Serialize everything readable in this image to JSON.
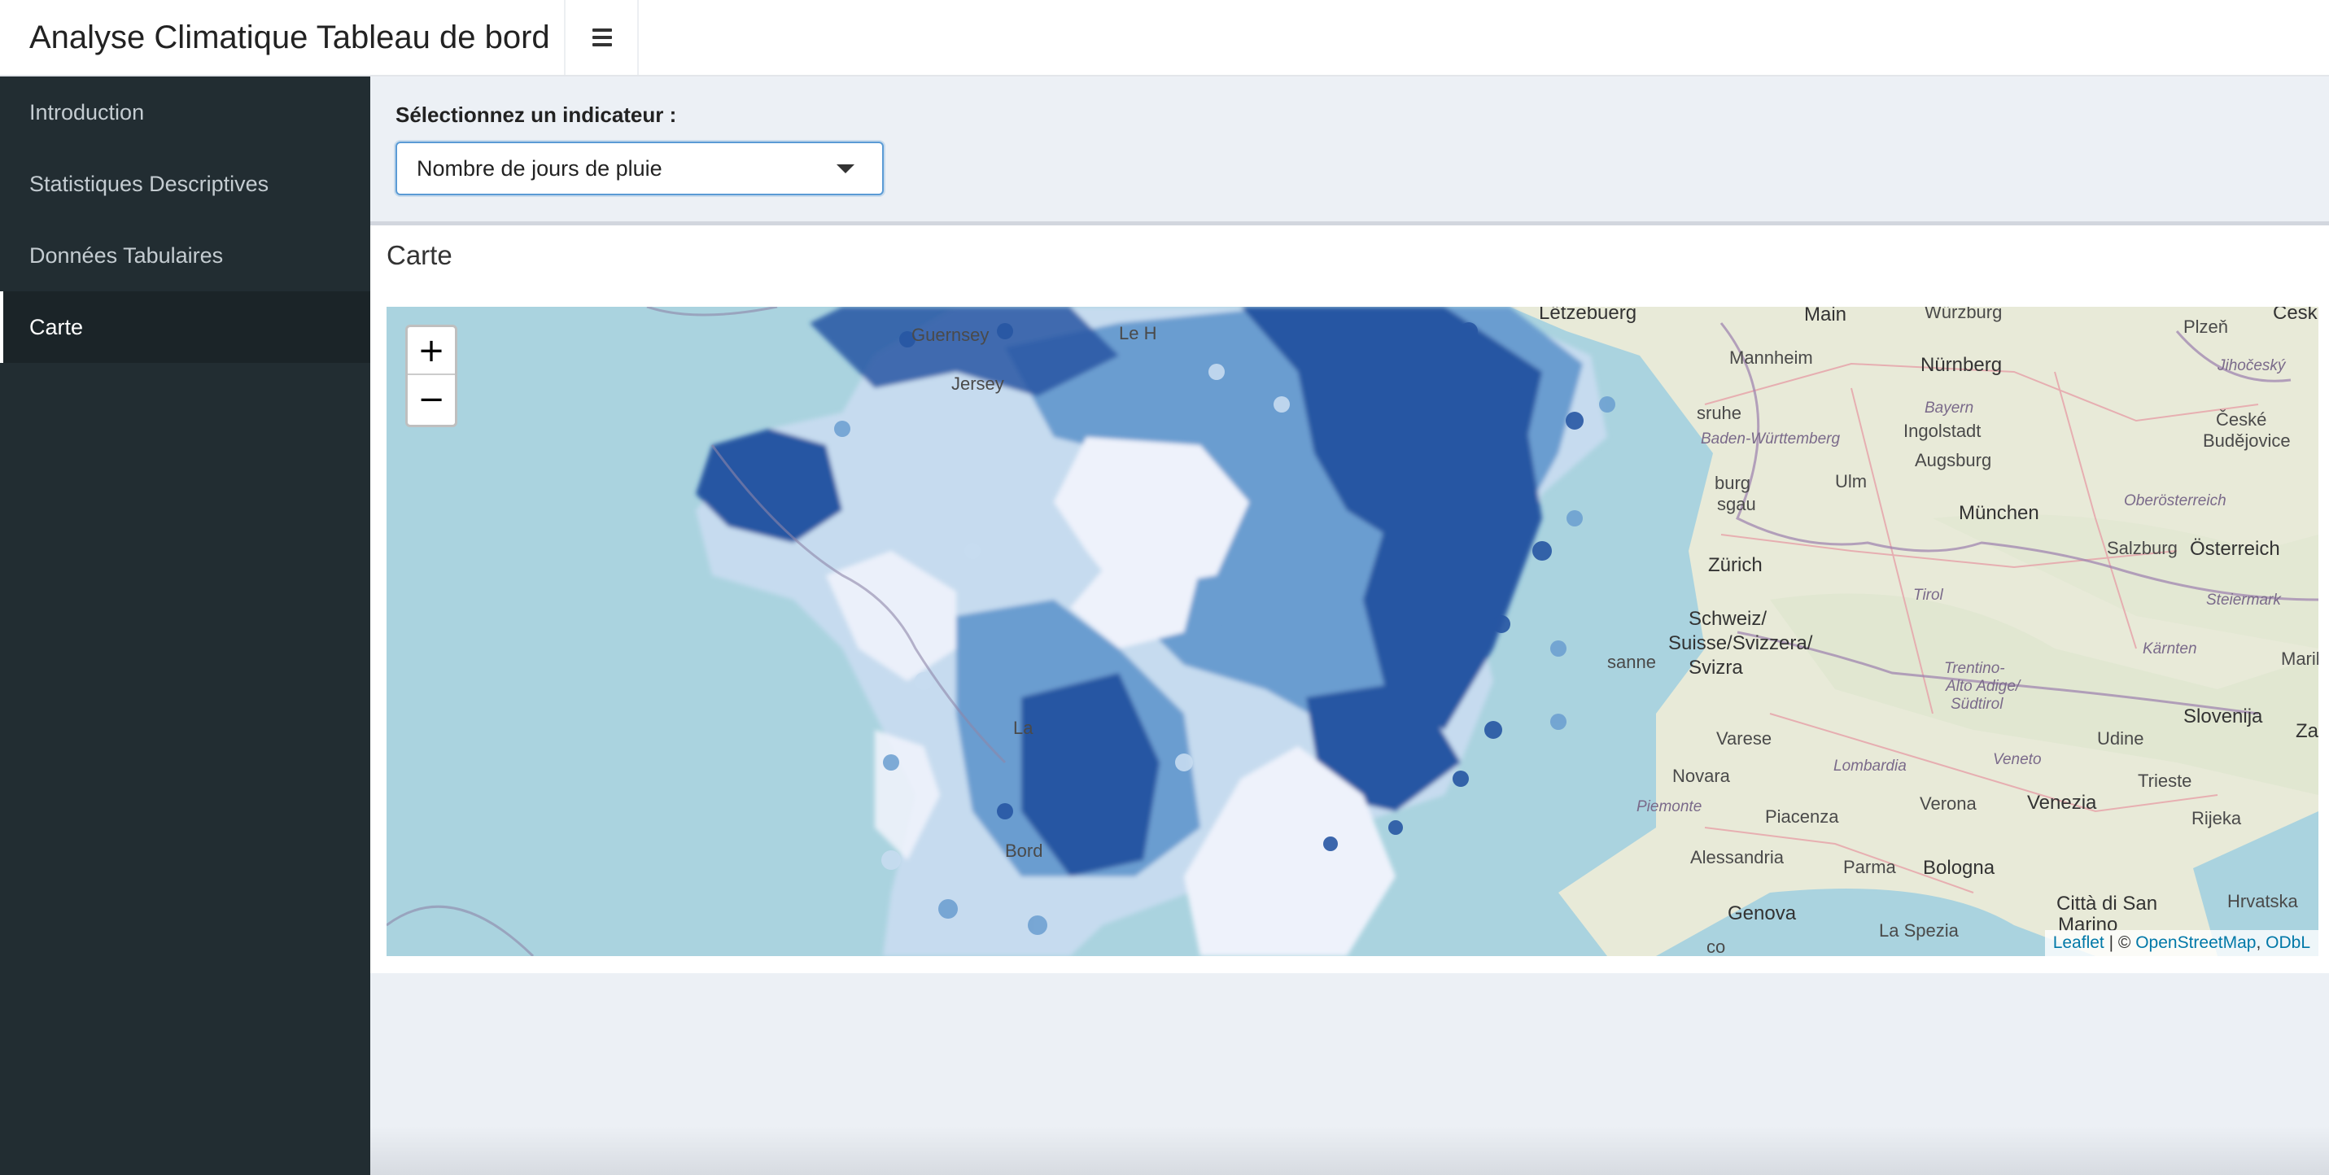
{
  "header": {
    "title": "Analyse Climatique Tableau de bord",
    "toggle_icon": "hamburger-menu-icon"
  },
  "sidebar": {
    "items": [
      {
        "label": "Introduction",
        "active": false
      },
      {
        "label": "Statistiques Descriptives",
        "active": false
      },
      {
        "label": "Données Tabulaires",
        "active": false
      },
      {
        "label": "Carte",
        "active": true
      }
    ]
  },
  "selector": {
    "label": "Sélectionnez un indicateur :",
    "value": "Nombre de jours de pluie"
  },
  "box": {
    "title": "Carte"
  },
  "map": {
    "zoom_in": "+",
    "zoom_out": "−",
    "attribution": {
      "leaflet": "Leaflet",
      "separator": " | © ",
      "osm": "OpenStreetMap",
      "comma": ", ",
      "license": "ODbL"
    },
    "labels": {
      "guernsey": "Guernsey",
      "jersey": "Jersey",
      "le_h": "Le H",
      "letzebuerg": "Lëtzebuerg",
      "main": "Main",
      "wurzburg": "Würzburg",
      "cesk": "Česk",
      "mannheim": "Mannheim",
      "nurnberg": "Nürnberg",
      "plzen": "Plzeň",
      "jihoceske": "Jihočeský",
      "bayern": "Bayern",
      "sruhe": "sruhe",
      "baden": "Baden-Württemberg",
      "ingolstadt": "Ingolstadt",
      "ceske": "České",
      "budejovice": "Budějovice",
      "augsburg": "Augsburg",
      "burg": "burg",
      "sgau": "sgau",
      "ulm": "Ulm",
      "munchen": "München",
      "ober": "Oberösterreich",
      "zurich": "Zürich",
      "salzburg": "Salzburg",
      "osterreich": "Österreich",
      "tirol": "Tirol",
      "steiermark": "Steiermark",
      "schweiz": "Schweiz/",
      "suisse": "Suisse/Svizzera/",
      "svizra": "Svizra",
      "sanne": "sanne",
      "karnten": "Kärnten",
      "marib": "Marib",
      "trentino": "Trentino-",
      "alto": "Alto Adige/",
      "sudtirol": "Südtirol",
      "la": "La",
      "varese": "Varese",
      "udine": "Udine",
      "slovenija": "Slovenija",
      "za": "Za",
      "lombardia": "Lombardia",
      "veneto": "Veneto",
      "novara": "Novara",
      "trieste": "Trieste",
      "piemonte": "Piemonte",
      "verona": "Verona",
      "venezia": "Venezia",
      "piacenza": "Piacenza",
      "rijeka": "Rijeka",
      "bord": "Bord",
      "alessandria": "Alessandria",
      "parma": "Parma",
      "bologna": "Bologna",
      "hrvatska": "Hrvatska",
      "citta": "Città di San",
      "marino": "Marino",
      "genova": "Genova",
      "spezia": "La Spezia",
      "co": "co"
    }
  },
  "colors": {
    "sidebar_bg": "#222d32",
    "ocean": "#aad3df",
    "land": "#e8ead8",
    "scale_dark": "#2756a3",
    "scale_mid": "#6a9dd0",
    "scale_light": "#c6dbef",
    "scale_pale": "#eef2fb"
  }
}
